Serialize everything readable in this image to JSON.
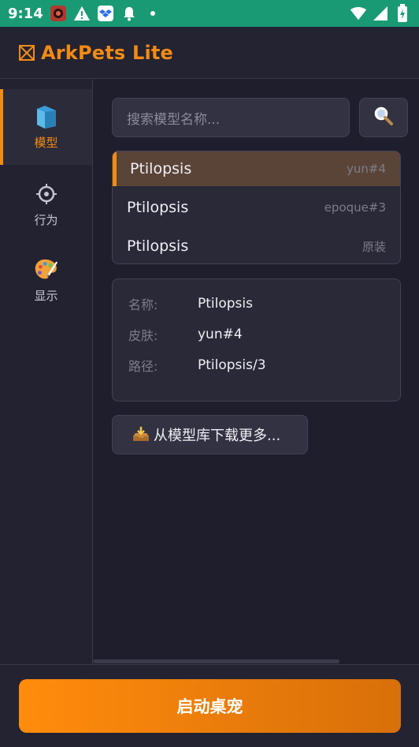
{
  "status_bar": {
    "time": "9:14",
    "left_icons": [
      "app-notification-icon",
      "warning-icon",
      "dropbox-icon",
      "bell-icon",
      "dot-icon"
    ],
    "right_icons": [
      "wifi-icon",
      "signal-icon",
      "battery-charging-icon"
    ]
  },
  "header": {
    "title": "ArkPets Lite",
    "accent": "#f28b14"
  },
  "sidebar": {
    "items": [
      {
        "label": "模型",
        "icon": "folder-icon",
        "active": true
      },
      {
        "label": "行为",
        "icon": "gear-icon",
        "active": false
      },
      {
        "label": "显示",
        "icon": "palette-icon",
        "active": false
      }
    ]
  },
  "search": {
    "placeholder": "搜索模型名称...",
    "button_icon": "search-icon"
  },
  "models": [
    {
      "name": "Ptilopsis",
      "tag": "yun#4",
      "selected": true
    },
    {
      "name": "Ptilopsis",
      "tag": "epoque#3",
      "selected": false
    },
    {
      "name": "Ptilopsis",
      "tag": "原装",
      "selected": false
    }
  ],
  "details": {
    "name_label": "名称:",
    "name_value": "Ptilopsis",
    "skin_label": "皮肤:",
    "skin_value": "yun#4",
    "path_label": "路径:",
    "path_value": "Ptilopsis/3"
  },
  "download": {
    "label": "从模型库下载更多...",
    "icon": "inbox-tray-icon"
  },
  "launch": {
    "label": "启动桌宠"
  }
}
